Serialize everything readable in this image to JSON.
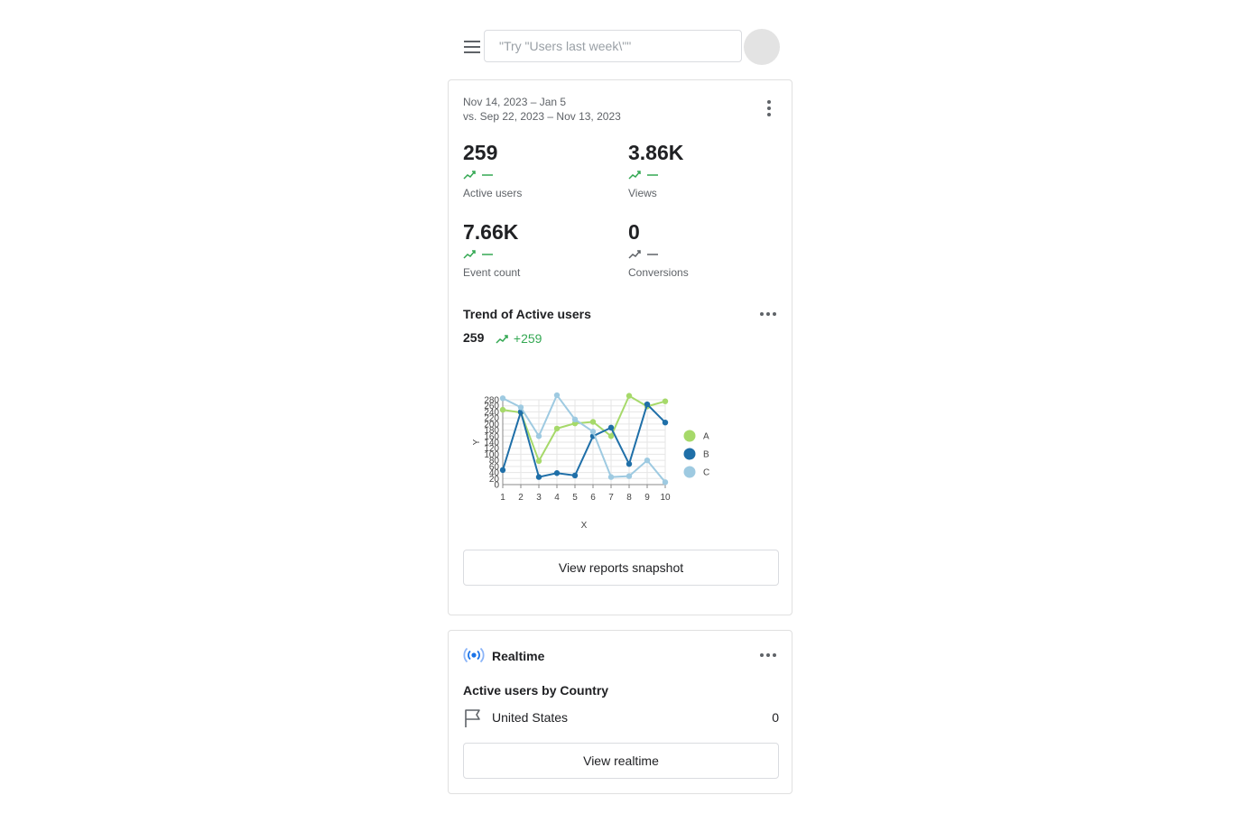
{
  "search": {
    "placeholder": "\"Try \"Users last week\\\"\""
  },
  "overview": {
    "date_range": "Nov 14, 2023 – Jan 5",
    "compare_range": "vs. Sep 22, 2023 – Nov 13, 2023",
    "metrics": [
      {
        "value": "259",
        "label": "Active users",
        "change": "—",
        "trend_color": "#34a853"
      },
      {
        "value": "3.86K",
        "label": "Views",
        "change": "—",
        "trend_color": "#34a853"
      },
      {
        "value": "7.66K",
        "label": "Event count",
        "change": "—",
        "trend_color": "#34a853"
      },
      {
        "value": "0",
        "label": "Conversions",
        "change": "—",
        "trend_color": "#5f6368"
      }
    ]
  },
  "trend": {
    "title": "Trend of Active users",
    "value": "259",
    "delta": "+259",
    "button_label": "View reports snapshot"
  },
  "chart_data": {
    "type": "line",
    "x": [
      1,
      2,
      3,
      4,
      5,
      6,
      7,
      8,
      9,
      10
    ],
    "xlabel": "X",
    "ylabel": "Y",
    "ylim": [
      0,
      280
    ],
    "yticks": [
      0,
      20,
      40,
      60,
      80,
      100,
      120,
      140,
      160,
      180,
      200,
      220,
      240,
      260,
      280
    ],
    "grid": true,
    "legend_position": "right",
    "series": [
      {
        "name": "A",
        "color": "#a6d96a",
        "values": [
          247,
          238,
          78,
          185,
          202,
          207,
          160,
          293,
          258,
          275
        ]
      },
      {
        "name": "B",
        "color": "#1f6fa8",
        "values": [
          48,
          240,
          25,
          38,
          30,
          160,
          188,
          68,
          265,
          205
        ]
      },
      {
        "name": "C",
        "color": "#9ecae1",
        "values": [
          285,
          255,
          160,
          295,
          215,
          175,
          25,
          28,
          80,
          8
        ]
      }
    ]
  },
  "realtime": {
    "title": "Realtime",
    "subtitle": "Active users by Country",
    "rows": [
      {
        "country": "United States",
        "value": "0"
      }
    ],
    "button_label": "View realtime"
  }
}
